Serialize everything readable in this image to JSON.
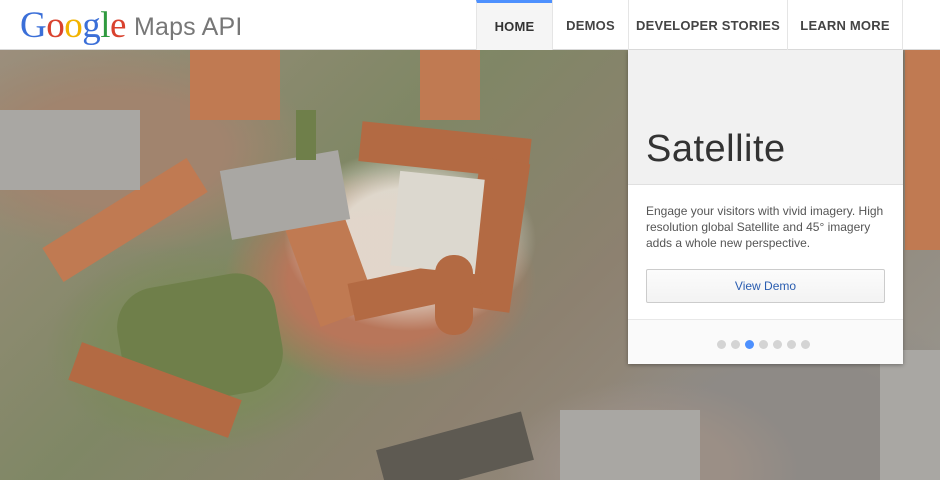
{
  "header": {
    "logo_letters": [
      "G",
      "o",
      "o",
      "g",
      "l",
      "e"
    ],
    "logo_colors": [
      "#3b6fd8",
      "#d9422e",
      "#f2b300",
      "#3b6fd8",
      "#2f9a3f",
      "#d9422e"
    ],
    "product": "Maps API",
    "nav": [
      {
        "label": "HOME",
        "active": true
      },
      {
        "label": "DEMOS",
        "active": false
      },
      {
        "label": "DEVELOPER STORIES",
        "active": false
      },
      {
        "label": "LEARN MORE",
        "active": false
      }
    ]
  },
  "card": {
    "title": "Satellite",
    "description": "Engage your visitors with vivid imagery. High resolution global Satellite and 45° imagery adds a whole new perspective.",
    "button_label": "View Demo",
    "carousel_count": 7,
    "carousel_active_index": 2
  },
  "colors": {
    "accent": "#4d90fe",
    "link": "#2a5db0"
  }
}
